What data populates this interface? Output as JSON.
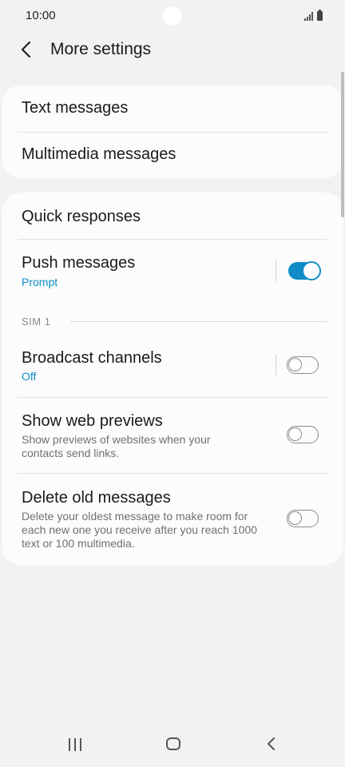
{
  "status": {
    "time": "10:00"
  },
  "header": {
    "title": "More settings"
  },
  "card1": {
    "items": [
      {
        "label": "Text messages"
      },
      {
        "label": "Multimedia messages"
      }
    ]
  },
  "card2": {
    "quick_responses": {
      "label": "Quick responses"
    },
    "push_messages": {
      "label": "Push messages",
      "sub": "Prompt",
      "toggle": "on"
    },
    "section": {
      "label": "SIM 1"
    },
    "broadcast": {
      "label": "Broadcast channels",
      "sub": "Off",
      "toggle": "off"
    },
    "web_previews": {
      "label": "Show web previews",
      "desc": "Show previews of websites when your contacts send links.",
      "toggle": "off"
    },
    "delete_old": {
      "label": "Delete old messages",
      "desc": "Delete your oldest message to make room for each new one you receive after you reach 1000 text or 100 multimedia.",
      "toggle": "off"
    }
  },
  "colors": {
    "accent": "#0f8cc6",
    "background": "#f2f2f2",
    "card": "#fcfcfc"
  }
}
